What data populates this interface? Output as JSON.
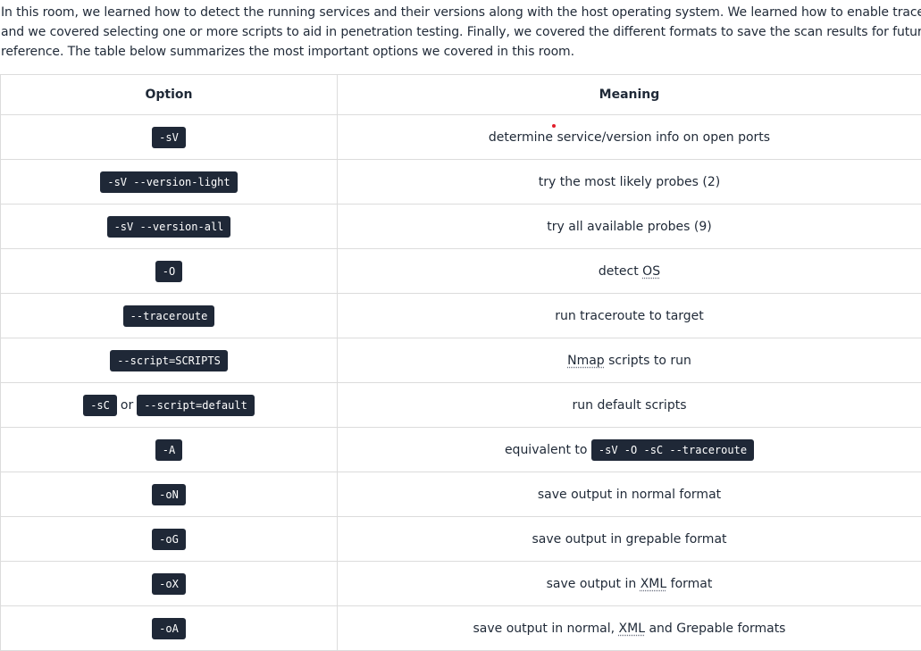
{
  "intro": {
    "line1": "In this room, we learned how to detect the running services and their versions along with the host operating system. We learned how to enable traceroute",
    "line2": "and we covered selecting one or more scripts to aid in penetration testing. Finally, we covered the different formats to save the scan results for future",
    "line3": "reference. The table below summarizes the most important options we covered in this room."
  },
  "table": {
    "headers": {
      "option": "Option",
      "meaning": "Meaning"
    },
    "rows": [
      {
        "option": "-sV",
        "meaning": "determine service/version info on open ports"
      },
      {
        "option": "-sV --version-light",
        "meaning": "try the most likely probes (2)"
      },
      {
        "option": "-sV --version-all",
        "meaning": "try all available probes (9)"
      },
      {
        "option": "-O",
        "meaning_pre": "detect ",
        "meaning_abbr": "OS"
      },
      {
        "option": "--traceroute",
        "meaning": "run traceroute to target"
      },
      {
        "option": "--script=SCRIPTS",
        "meaning_abbr": "Nmap",
        "meaning_post": " scripts to run"
      },
      {
        "option_a": "-sC",
        "option_sep": "or",
        "option_b": "--script=default",
        "meaning": "run default scripts"
      },
      {
        "option": "-A",
        "meaning_pre": "equivalent to ",
        "meaning_code": "-sV -O -sC --traceroute"
      },
      {
        "option": "-oN",
        "meaning": "save output in normal format"
      },
      {
        "option": "-oG",
        "meaning": "save output in grepable format"
      },
      {
        "option": "-oX",
        "meaning_pre": "save output in ",
        "meaning_abbr": "XML",
        "meaning_post": " format"
      },
      {
        "option": "-oA",
        "meaning_pre": "save output in normal, ",
        "meaning_abbr": "XML",
        "meaning_post": " and Grepable formats"
      }
    ]
  }
}
